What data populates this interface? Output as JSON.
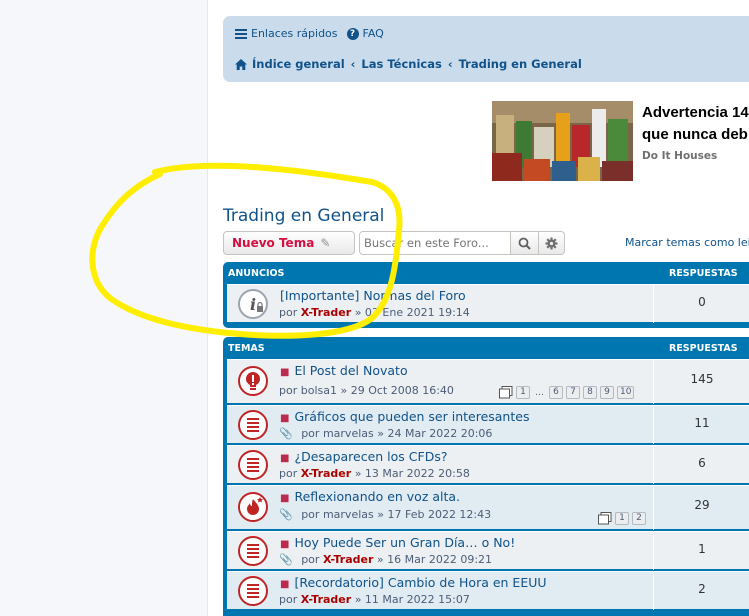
{
  "quick_links": {
    "menu_label": "Enlaces rápidos",
    "faq_label": "FAQ"
  },
  "breadcrumb": [
    "Índice general",
    "Las Técnicas",
    "Trading en General"
  ],
  "ad": {
    "title_line1": "Advertencia 14",
    "title_line2": "que nunca deb",
    "source": "Do It Houses"
  },
  "forum_title": "Trading en General",
  "new_topic_label": "Nuevo Tema",
  "search": {
    "placeholder": "Buscar en este Foro..."
  },
  "mark_read_label": "Marcar temas como lei",
  "announcements": {
    "header": "ANUNCIOS",
    "replies_header": "RESPUESTAS",
    "rows": [
      {
        "title": "[Importante] Normas del Foro",
        "by": "por",
        "author": "X-Trader",
        "date": "» 03 Ene 2021 19:14",
        "replies": "0"
      }
    ]
  },
  "topics": {
    "header": "TEMAS",
    "replies_header": "RESPUESTAS",
    "rows": [
      {
        "title": "El Post del Novato",
        "by": "por",
        "author": "bolsa1",
        "date": "» 29 Oct 2008 16:40",
        "replies": "145",
        "pages": [
          "1",
          "6",
          "7",
          "8",
          "9",
          "10"
        ],
        "ellipsis": "…"
      },
      {
        "title": "Gráficos que pueden ser interesantes",
        "by": "por",
        "author": "marvelas",
        "date": "» 24 Mar 2022 20:06",
        "replies": "11"
      },
      {
        "title": "¿Desaparecen los CFDs?",
        "by": "por",
        "author": "X-Trader",
        "date": "» 13 Mar 2022 20:58",
        "replies": "6"
      },
      {
        "title": "Reflexionando en voz alta.",
        "by": "por",
        "author": "marvelas",
        "date": "» 17 Feb 2022 12:43",
        "replies": "29",
        "pages": [
          "1",
          "2"
        ]
      },
      {
        "title": "Hoy Puede Ser un Gran Día… o No!",
        "by": "por",
        "author": "X-Trader",
        "date": "» 16 Mar 2022 09:21",
        "replies": "1"
      },
      {
        "title": "[Recordatorio] Cambio de Hora en EEUU",
        "by": "por",
        "author": "X-Trader",
        "date": "» 11 Mar 2022 15:07",
        "replies": "2"
      }
    ]
  },
  "colors": {
    "accent": "#105289",
    "header_blue": "#0076b1",
    "highlight": "#ffee00",
    "author_red": "#aa0000"
  }
}
